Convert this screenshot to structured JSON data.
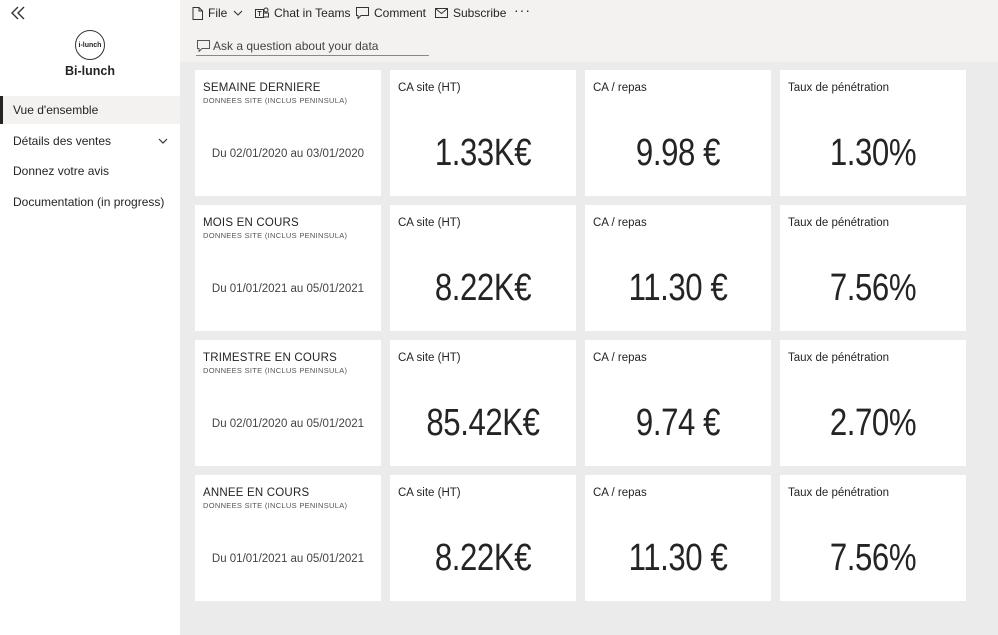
{
  "brand": {
    "name": "Bi-lunch",
    "logo_text": "i-lunch"
  },
  "nav": {
    "items": [
      {
        "label": "Vue d'ensemble",
        "active": true
      },
      {
        "label": "Détails des ventes",
        "expandable": true
      },
      {
        "label": "Donnez votre avis"
      },
      {
        "label": "Documentation (in progress)"
      }
    ]
  },
  "toolbar": {
    "file": "File",
    "chat": "Chat in Teams",
    "comment": "Comment",
    "subscribe": "Subscribe",
    "more": "···"
  },
  "qna": {
    "placeholder": "Ask a question about your data"
  },
  "rows": [
    {
      "period": "SEMAINE DERNIERE",
      "subtitle": "DONNEES SITE (INCLUS PENINSULA)",
      "range": "Du 02/01/2020 au 03/01/2020",
      "kpis": [
        {
          "label": "CA site (HT)",
          "value": "1.33K€"
        },
        {
          "label": "CA / repas",
          "value": "9.98 €"
        },
        {
          "label": "Taux de pénétration",
          "value": "1.30%"
        }
      ]
    },
    {
      "period": "MOIS EN COURS",
      "subtitle": "DONNEES SITE (INCLUS PENINSULA)",
      "range": "Du 01/01/2021 au 05/01/2021",
      "kpis": [
        {
          "label": "CA site (HT)",
          "value": "8.22K€"
        },
        {
          "label": "CA / repas",
          "value": "11.30 €"
        },
        {
          "label": "Taux de pénétration",
          "value": "7.56%"
        }
      ]
    },
    {
      "period": "TRIMESTRE EN COURS",
      "subtitle": "DONNEES SITE (INCLUS PENINSULA)",
      "range": "Du 02/01/2020 au 05/01/2021",
      "kpis": [
        {
          "label": "CA site (HT)",
          "value": "85.42K€"
        },
        {
          "label": "CA / repas",
          "value": "9.74 €"
        },
        {
          "label": "Taux de pénétration",
          "value": "2.70%"
        }
      ]
    },
    {
      "period": "ANNEE EN COURS",
      "subtitle": "DONNEES SITE (INCLUS PENINSULA)",
      "range": "Du 01/01/2021 au 05/01/2021",
      "kpis": [
        {
          "label": "CA site (HT)",
          "value": "8.22K€"
        },
        {
          "label": "CA / repas",
          "value": "11.30 €"
        },
        {
          "label": "Taux de pénétration",
          "value": "7.56%"
        }
      ]
    }
  ]
}
